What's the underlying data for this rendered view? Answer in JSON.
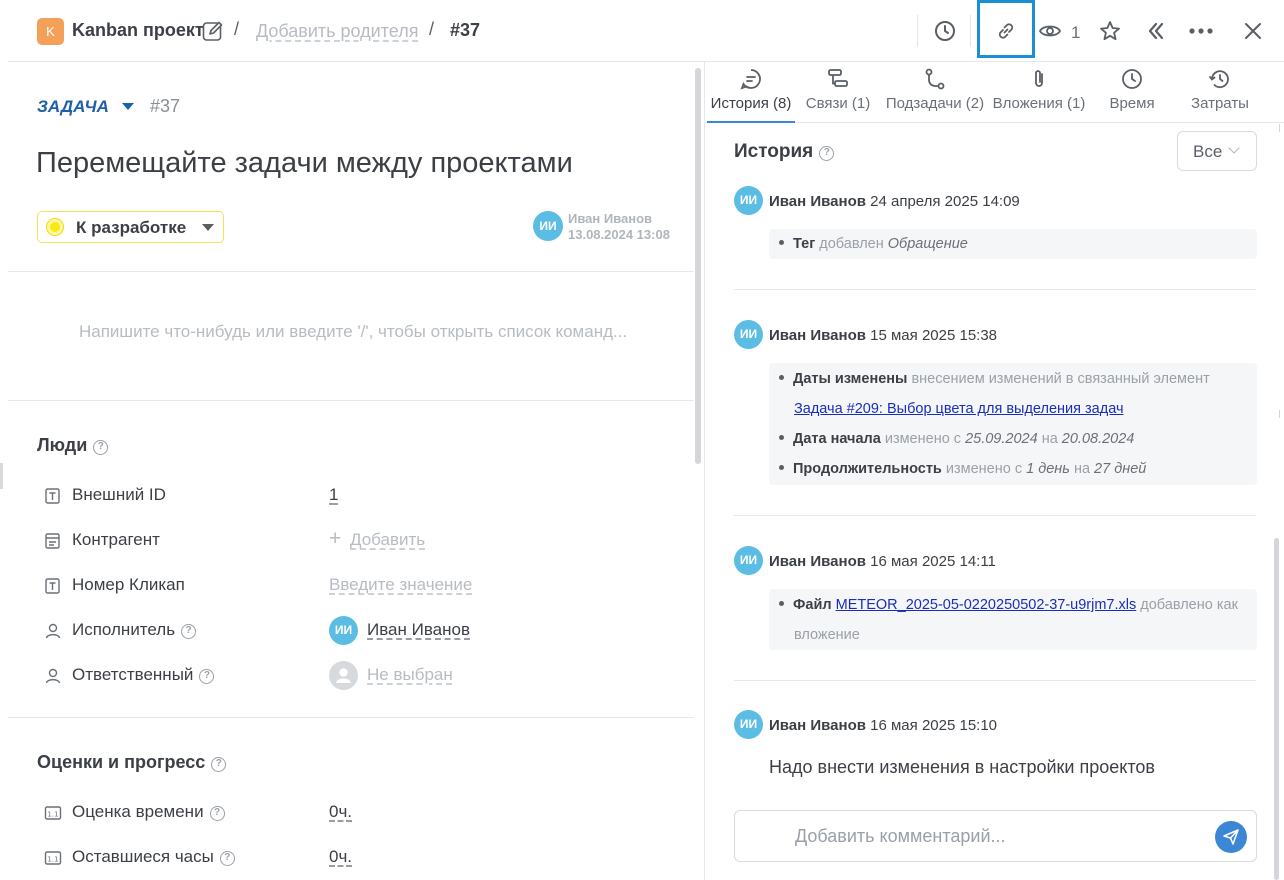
{
  "header": {
    "project_badge": "K",
    "project_name": "Kanban проект",
    "sep": "/",
    "add_parent": "Добавить родителя",
    "task_id": "#37",
    "watchers_count": "1"
  },
  "task": {
    "type": "ЗАДАЧА",
    "id": "#37",
    "title": "Перемещайте задачи между проектами",
    "status": "К разработке",
    "author_initials": "ИИ",
    "author_name": "Иван Иванов",
    "author_date": "13.08.2024 13:08",
    "editor_placeholder": "Напишите что-нибудь или введите '/', чтобы открыть список команд..."
  },
  "people": {
    "title": "Люди",
    "fields": [
      {
        "label": "Внешний ID",
        "value": "1"
      },
      {
        "label": "Контрагент",
        "value": "Добавить"
      },
      {
        "label": "Номер Кликап",
        "value": "Введите значение"
      },
      {
        "label": "Исполнитель",
        "value": "Иван Иванов",
        "initials": "ИИ"
      },
      {
        "label": "Ответственный",
        "value": "Не выбран"
      }
    ]
  },
  "estimates": {
    "title": "Оценки и прогресс",
    "fields": [
      {
        "label": "Оценка времени",
        "value": "0ч."
      },
      {
        "label": "Оставшиеся часы",
        "value": "0ч."
      }
    ]
  },
  "tabs": [
    {
      "label": "История (8)",
      "icon": "chat-icon"
    },
    {
      "label": "Связи (1)",
      "icon": "relations-icon"
    },
    {
      "label": "Подзадачи (2)",
      "icon": "subtasks-icon"
    },
    {
      "label": "Вложения (1)",
      "icon": "paperclip-icon"
    },
    {
      "label": "Время",
      "icon": "clock-icon"
    },
    {
      "label": "Затраты",
      "icon": "history-clock-icon"
    }
  ],
  "history": {
    "title": "История",
    "filter": "Все",
    "entries": [
      {
        "initials": "ИИ",
        "author": "Иван Иванов",
        "date": "24 апреля 2025 14:09",
        "items": [
          {
            "bold": "Тег",
            "text": "добавлен",
            "italic": "Обращение"
          }
        ]
      },
      {
        "initials": "ИИ",
        "author": "Иван Иванов",
        "date": "15 мая 2025 15:38",
        "items": [
          {
            "bold": "Даты изменены",
            "text": "внесением изменений в связанный элемент",
            "link": "Задача #209: Выбор цвета для выделения задач"
          },
          {
            "bold": "Дата начала",
            "text1": "изменено с",
            "from": "25.09.2024",
            "text2": "на",
            "to": "20.08.2024"
          },
          {
            "bold": "Продолжительность",
            "text1": "изменено с",
            "from": "1 день",
            "text2": "на",
            "to": "27 дней"
          }
        ]
      },
      {
        "initials": "ИИ",
        "author": "Иван Иванов",
        "date": "16 мая 2025 14:11",
        "items": [
          {
            "bold": "Файл",
            "link": "METEOR_2025-05-0220250502-37-u9rjm7.xls",
            "text": "добавлено как",
            "text_cont": "вложение"
          }
        ]
      },
      {
        "initials": "ИИ",
        "author": "Иван Иванов",
        "date": "16 мая 2025 15:10",
        "comment": "Надо внести изменения в настройки проектов"
      }
    ]
  },
  "composer": {
    "placeholder": "Добавить комментарий..."
  },
  "colors": {
    "accent": "#3c86d6",
    "avatar": "#5bbde4",
    "project_badge": "#f4a058",
    "status_yellow": "#fbe910",
    "highlight_frame": "#1a8fd4"
  }
}
